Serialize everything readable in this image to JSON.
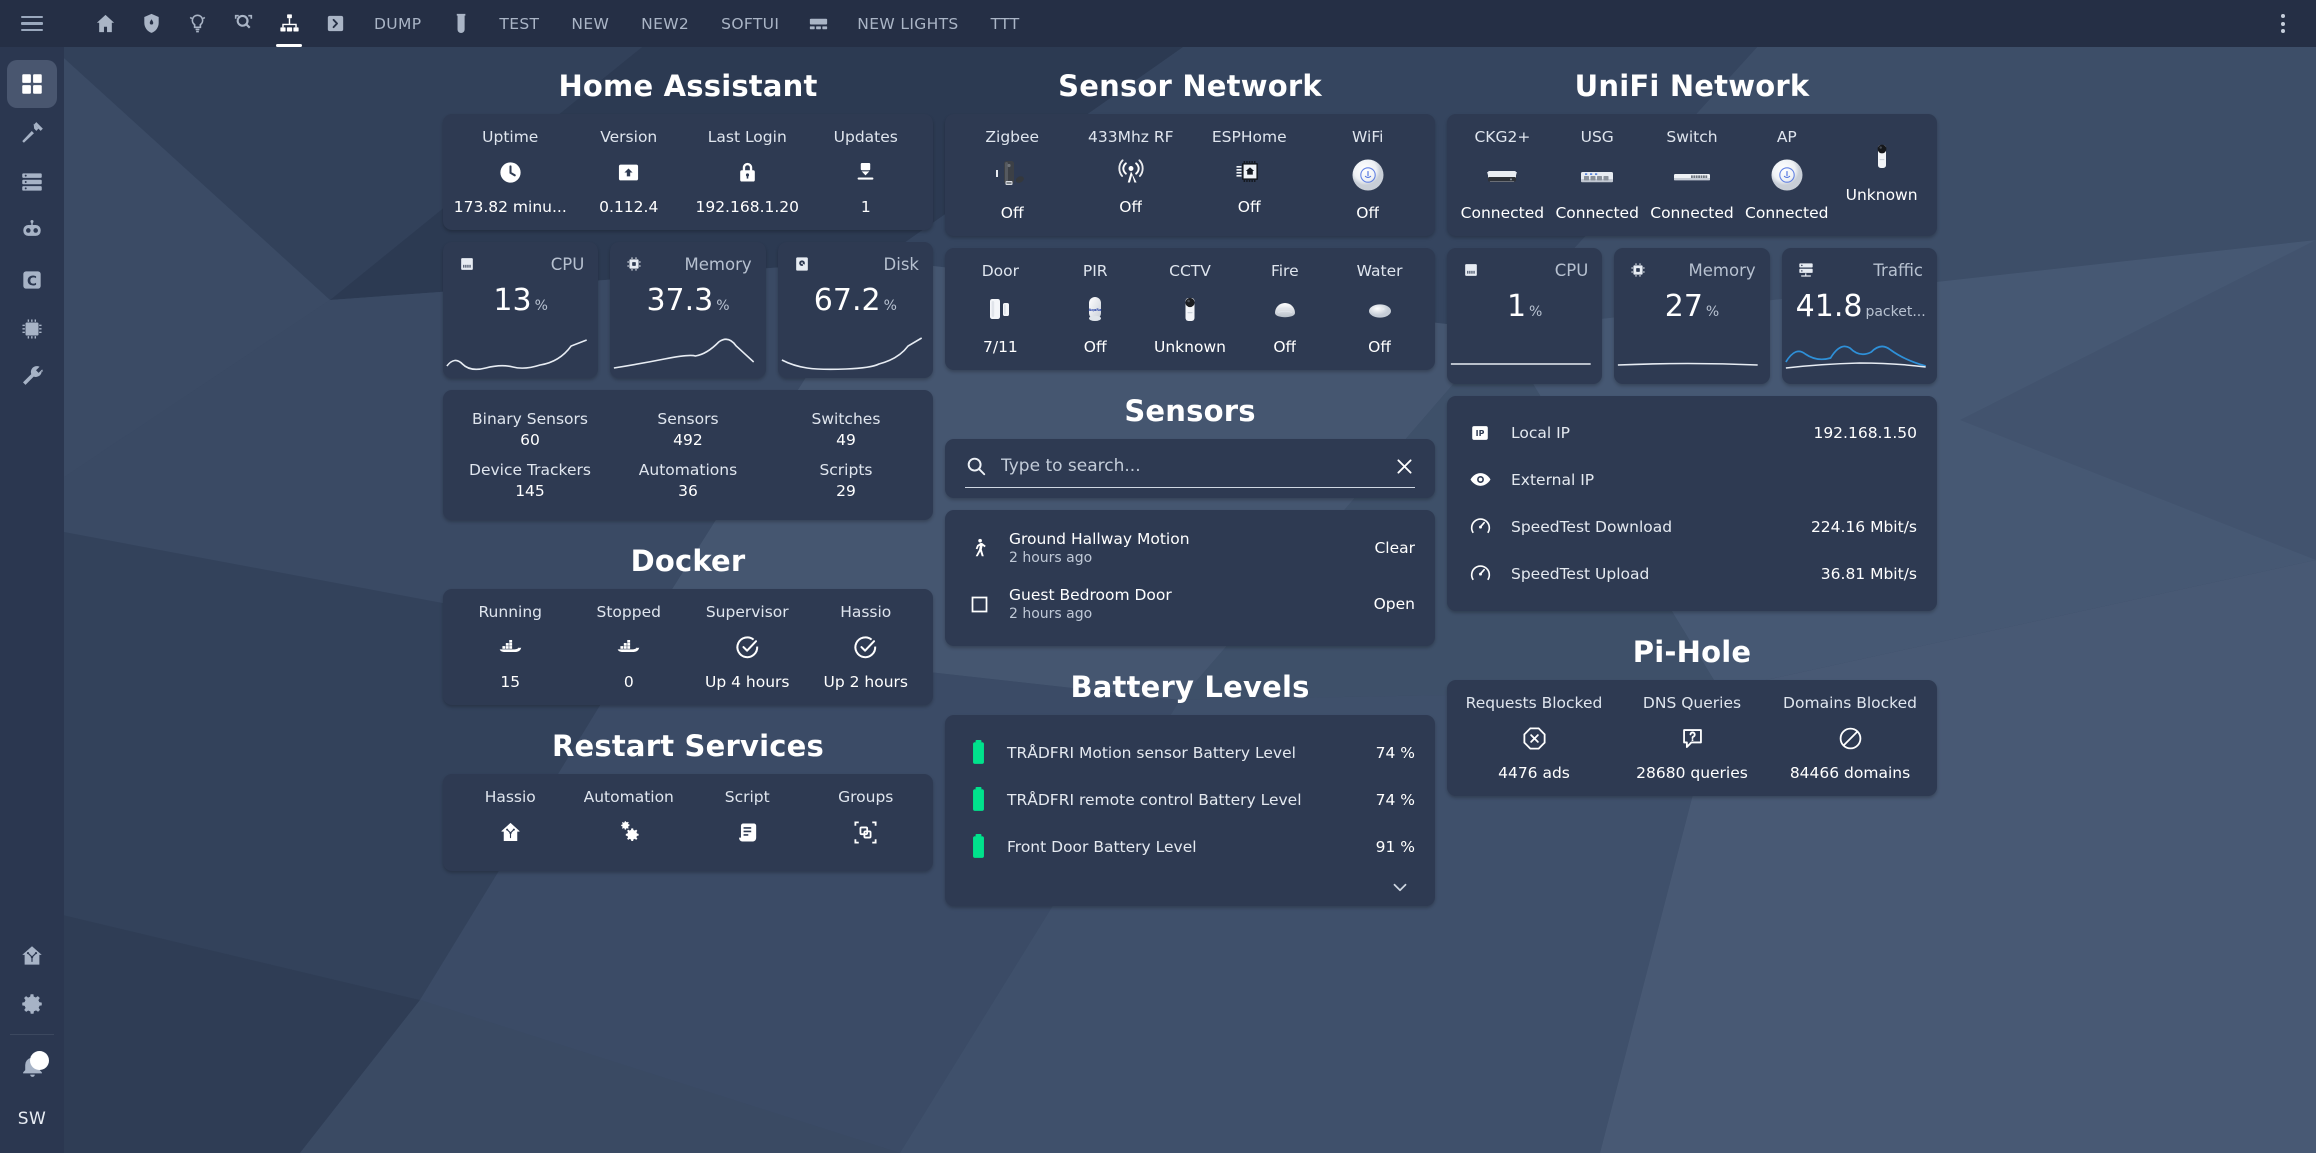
{
  "sidebar": {
    "menu_icon": "hamburger-icon",
    "items": [
      {
        "name": "dashboard",
        "icon": "grid-icon",
        "active": true
      },
      {
        "name": "developer-tools",
        "icon": "hammer-icon",
        "active": false
      },
      {
        "name": "server",
        "icon": "server-icon",
        "active": false
      },
      {
        "name": "robot",
        "icon": "robot-icon",
        "active": false
      },
      {
        "name": "compensation",
        "icon": "c-badge-icon",
        "active": false
      },
      {
        "name": "chip",
        "icon": "chip-icon",
        "active": false
      },
      {
        "name": "tools",
        "icon": "wrench-icon",
        "active": false
      }
    ],
    "bottom_items": [
      {
        "name": "home-assistant",
        "icon": "home-assistant-icon"
      },
      {
        "name": "settings",
        "icon": "gear-icon"
      },
      {
        "name": "notifications",
        "icon": "bell-icon",
        "has_dot": true
      }
    ],
    "user_initials": "SW"
  },
  "topbar": {
    "tabs": [
      {
        "label": "",
        "icon": "home-icon",
        "active": false
      },
      {
        "label": "",
        "icon": "shield-icon",
        "active": false
      },
      {
        "label": "",
        "icon": "lightbulb-icon",
        "active": false
      },
      {
        "label": "",
        "icon": "magnify-scan-icon",
        "active": false
      },
      {
        "label": "",
        "icon": "sitemap-icon",
        "active": true
      },
      {
        "label": "",
        "icon": "chevron-right-box-icon",
        "active": false
      },
      {
        "label": "DUMP",
        "icon": "",
        "active": false
      },
      {
        "label": "",
        "icon": "test-tube-icon",
        "active": false
      },
      {
        "label": "TEST",
        "icon": "",
        "active": false
      },
      {
        "label": "NEW",
        "icon": "",
        "active": false
      },
      {
        "label": "NEW2",
        "icon": "",
        "active": false
      },
      {
        "label": "SOFTUI",
        "icon": "",
        "active": false
      },
      {
        "label": "",
        "icon": "view-dashboard-icon",
        "active": false
      },
      {
        "label": "NEW LIGHTS",
        "icon": "",
        "active": false
      },
      {
        "label": "TTT",
        "icon": "",
        "active": false
      }
    ],
    "overflow_icon": "kebab-menu-icon"
  },
  "colors": {
    "accent": "#41a0dd",
    "battery_green": "#00e28c",
    "card_bg": "#2e3a52",
    "sidebar_bg": "#2b3750",
    "topbar_bg": "#252f45"
  },
  "column_left": {
    "home_assistant": {
      "title": "Home Assistant",
      "cells": [
        {
          "name": "Uptime",
          "icon": "clock-icon",
          "state": "173.82 minu..."
        },
        {
          "name": "Version",
          "icon": "package-up-icon",
          "state": "0.112.4"
        },
        {
          "name": "Last Login",
          "icon": "lock-icon",
          "state": "192.168.1.20"
        },
        {
          "name": "Updates",
          "icon": "package-down-icon",
          "state": "1"
        }
      ]
    },
    "gauges": [
      {
        "title": "CPU",
        "icon": "memory-icon",
        "value": "13",
        "unit": "%",
        "line": "white"
      },
      {
        "title": "Memory",
        "icon": "chip-icon",
        "value": "37.3",
        "unit": "%",
        "line": "white"
      },
      {
        "title": "Disk",
        "icon": "harddisk-icon",
        "value": "67.2",
        "unit": "%",
        "line": "white"
      }
    ],
    "counts": [
      {
        "name": "Binary Sensors",
        "value": "60"
      },
      {
        "name": "Sensors",
        "value": "492"
      },
      {
        "name": "Switches",
        "value": "49"
      },
      {
        "name": "Device Trackers",
        "value": "145"
      },
      {
        "name": "Automations",
        "value": "36"
      },
      {
        "name": "Scripts",
        "value": "29"
      }
    ],
    "docker": {
      "title": "Docker",
      "cells": [
        {
          "name": "Running",
          "icon": "docker-icon",
          "state": "15"
        },
        {
          "name": "Stopped",
          "icon": "docker-icon",
          "state": "0"
        },
        {
          "name": "Supervisor",
          "icon": "check-circle-icon",
          "state": "Up 4 hours"
        },
        {
          "name": "Hassio",
          "icon": "check-circle-icon",
          "state": "Up 2 hours"
        }
      ]
    },
    "restart": {
      "title": "Restart Services",
      "cells": [
        {
          "name": "Hassio",
          "icon": "home-assistant-icon"
        },
        {
          "name": "Automation",
          "icon": "cogs-icon"
        },
        {
          "name": "Script",
          "icon": "script-icon"
        },
        {
          "name": "Groups",
          "icon": "group-icon"
        }
      ]
    }
  },
  "column_middle": {
    "sensor_network": {
      "title": "Sensor Network",
      "cells": [
        {
          "name": "Zigbee",
          "icon": "zigbee-usb-stick-image",
          "state": "Off"
        },
        {
          "name": "433Mhz RF",
          "icon": "broadcast-icon",
          "state": "Off"
        },
        {
          "name": "ESPHome",
          "icon": "esphome-chip-icon",
          "state": "Off"
        },
        {
          "name": "WiFi",
          "icon": "unifi-ap-image",
          "state": "Off"
        }
      ]
    },
    "sensors_row": [
      {
        "name": "Door",
        "icon": "door-contact-sensor-image",
        "state": "7/11"
      },
      {
        "name": "PIR",
        "icon": "pir-sensor-image",
        "state": "Off"
      },
      {
        "name": "CCTV",
        "icon": "cctv-camera-image",
        "state": "Unknown"
      },
      {
        "name": "Fire",
        "icon": "smoke-detector-image",
        "state": "Off"
      },
      {
        "name": "Water",
        "icon": "water-sensor-image",
        "state": "Off"
      }
    ],
    "sensors": {
      "title": "Sensors",
      "search": {
        "placeholder": "Type to search...",
        "value": "",
        "icon": "search-icon",
        "clear_icon": "close-icon"
      },
      "rows": [
        {
          "icon": "walk-icon",
          "name": "Ground Hallway Motion",
          "time": "2 hours ago",
          "value": "Clear"
        },
        {
          "icon": "square-outline-icon",
          "name": "Guest Bedroom Door",
          "time": "2 hours ago",
          "value": "Open"
        }
      ]
    },
    "battery": {
      "title": "Battery Levels",
      "rows": [
        {
          "icon": "battery-icon",
          "name": "TRÅDFRI Motion sensor Battery Level",
          "value": "74 %"
        },
        {
          "icon": "battery-icon",
          "name": "TRÅDFRI remote control Battery Level",
          "value": "74 %"
        },
        {
          "icon": "battery-icon",
          "name": "Front Door Battery Level",
          "value": "91 %"
        }
      ],
      "expand_icon": "chevron-down-icon"
    }
  },
  "column_right": {
    "unifi": {
      "title": "UniFi Network",
      "cells": [
        {
          "name": "CKG2+",
          "icon": "cloudkey-image",
          "state": "Connected"
        },
        {
          "name": "USG",
          "icon": "usg-router-image",
          "state": "Connected"
        },
        {
          "name": "Switch",
          "icon": "unifi-switch-image",
          "state": "Connected"
        },
        {
          "name": "AP",
          "icon": "unifi-ap-image",
          "state": "Connected"
        },
        {
          "name": "",
          "icon": "unifi-camera-image",
          "state": "Unknown"
        }
      ]
    },
    "gauges": [
      {
        "title": "CPU",
        "icon": "memory-icon",
        "value": "1",
        "unit": "%",
        "line": "white"
      },
      {
        "title": "Memory",
        "icon": "chip-icon",
        "value": "27",
        "unit": "%",
        "line": "white"
      },
      {
        "title": "Traffic",
        "icon": "server-icon",
        "value": "41.8",
        "unit": "packet...",
        "line": "blue"
      }
    ],
    "network_info": [
      {
        "icon": "ip-icon",
        "name": "Local IP",
        "value": "192.168.1.50"
      },
      {
        "icon": "eye-icon",
        "name": "External IP",
        "value": ""
      },
      {
        "icon": "speedometer-icon",
        "name": "SpeedTest Download",
        "value": "224.16 Mbit/s"
      },
      {
        "icon": "speedometer-icon",
        "name": "SpeedTest Upload",
        "value": "36.81 Mbit/s"
      }
    ],
    "pihole": {
      "title": "Pi-Hole",
      "cells": [
        {
          "name": "Requests Blocked",
          "icon": "close-octagon-icon",
          "state": "4476 ads"
        },
        {
          "name": "DNS Queries",
          "icon": "comment-question-icon",
          "state": "28680 queries"
        },
        {
          "name": "Domains Blocked",
          "icon": "cancel-icon",
          "state": "84466 domains"
        }
      ]
    }
  }
}
